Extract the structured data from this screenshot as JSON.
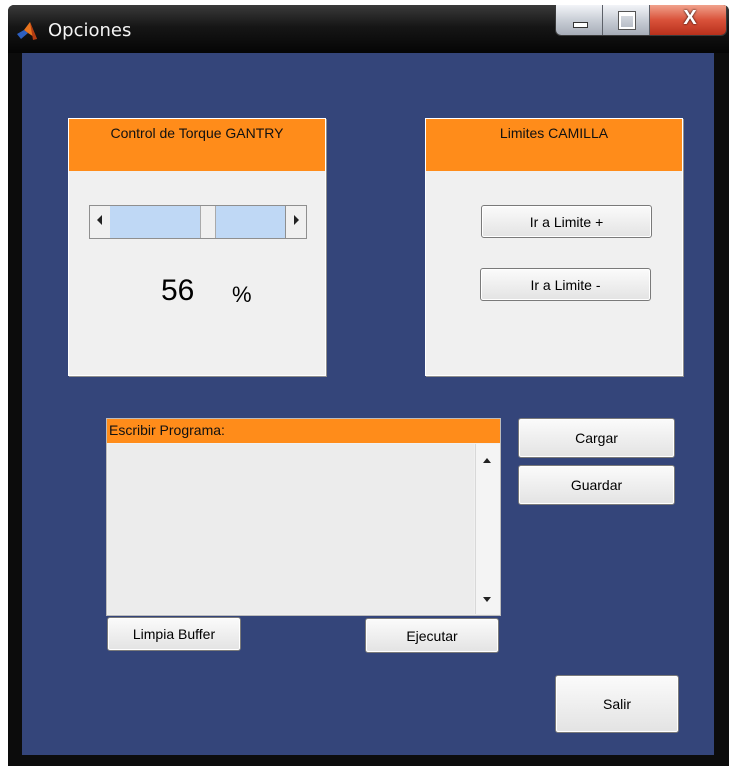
{
  "window": {
    "title": "Opciones",
    "icon": "matlab-logo-icon",
    "controls": [
      "minimize-icon",
      "maximize-icon",
      "close-icon"
    ],
    "close_glyph": "X"
  },
  "colors": {
    "background": "#34457a",
    "panel": "#f0f0f0",
    "header_accent": "#ff8c1a",
    "slider_track": "#bfd8f5"
  },
  "torque_panel": {
    "title": "Control de Torque GANTRY",
    "slider_value_percent": 56,
    "value": "56",
    "unit": "%"
  },
  "limits_panel": {
    "title": "Limites CAMILLA",
    "limit_plus": "Ir a Limite +",
    "limit_minus": "Ir a Limite -"
  },
  "program_panel": {
    "title": "Escribir Programa:",
    "text": "",
    "clear_buffer": "Limpia Buffer",
    "execute": "Ejecutar"
  },
  "actions": {
    "load": "Cargar",
    "save": "Guardar",
    "exit": "Salir"
  }
}
